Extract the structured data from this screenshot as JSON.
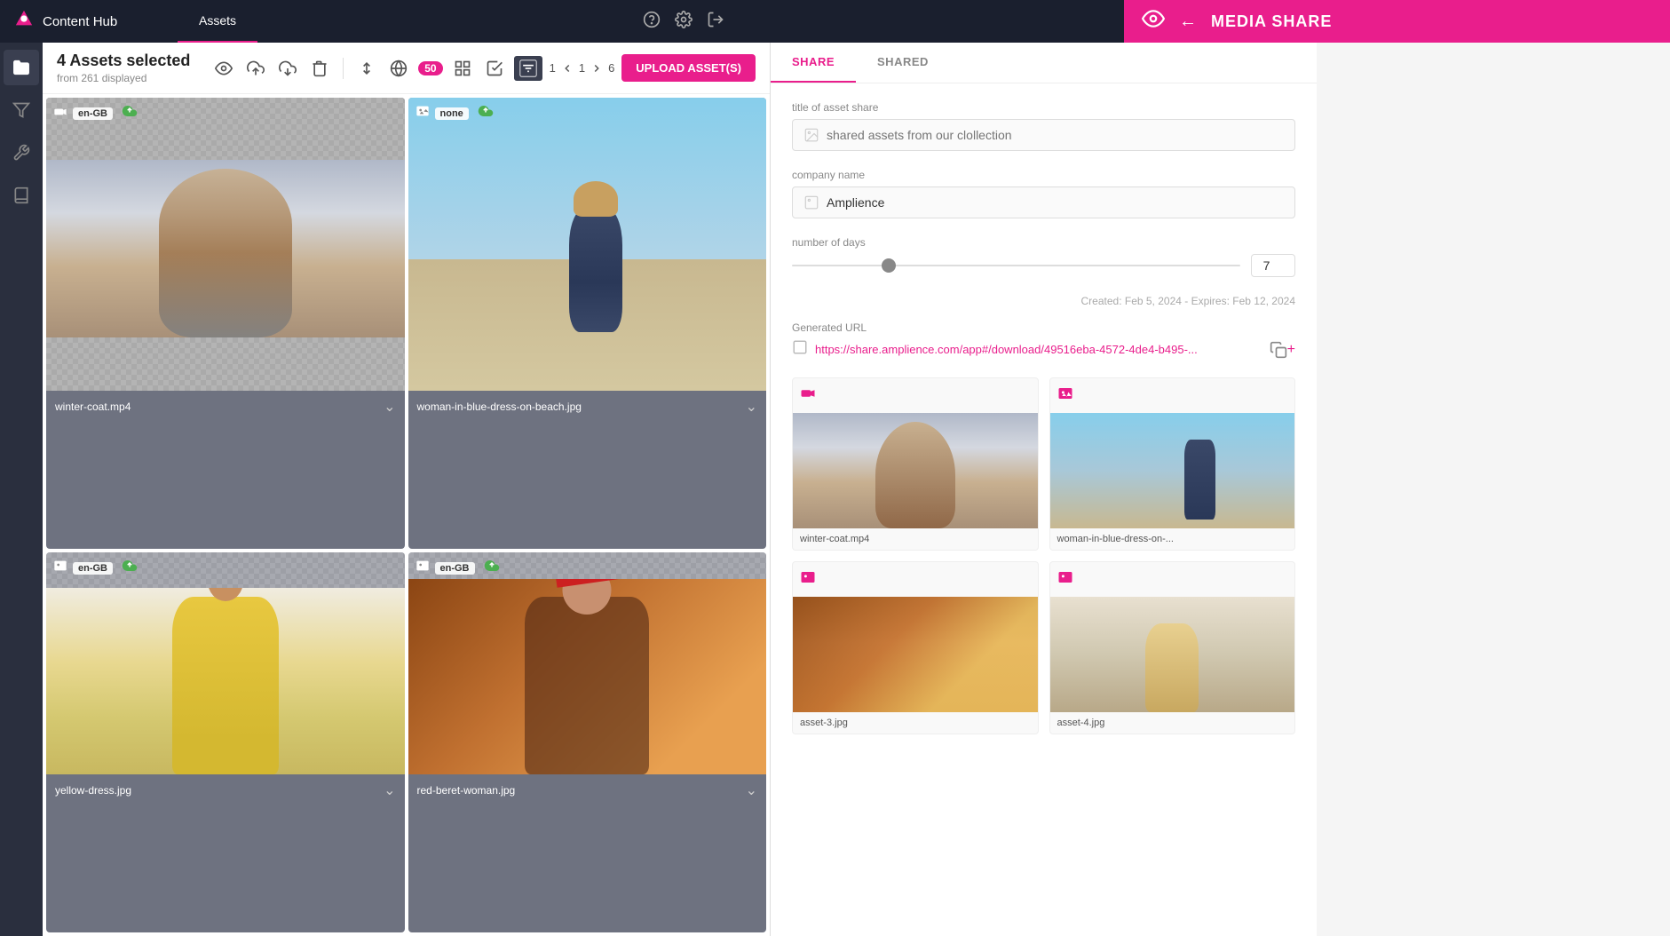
{
  "app": {
    "brand_icon": "△",
    "title": "Content Hub",
    "active_tab": "Assets",
    "tabs": [
      "Assets"
    ]
  },
  "topnav": {
    "right_icons": [
      "help",
      "settings",
      "export"
    ]
  },
  "sidebar": {
    "items": [
      {
        "name": "folder-icon",
        "icon": "📁",
        "active": true
      },
      {
        "name": "filter-icon",
        "icon": "⚗"
      },
      {
        "name": "tools-icon",
        "icon": "🔧"
      },
      {
        "name": "book-icon",
        "icon": "📖"
      }
    ]
  },
  "toolbar": {
    "assets_selected": "4 Assets selected",
    "from_displayed": "from 261 displayed",
    "page_current": "1",
    "page_arrow_left": "‹",
    "page_middle": "1",
    "page_arrow_right": "›",
    "page_end": "6",
    "per_page": "50",
    "upload_button": "UPLOAD ASSET(S)"
  },
  "assets": [
    {
      "name": "winter-coat.mp4",
      "locale": "en-GB",
      "type": "video",
      "has_cloud": true
    },
    {
      "name": "woman-in-blue-dress-on-beach.jpg",
      "locale": "none",
      "type": "image",
      "has_cloud": true
    },
    {
      "name": "yellow-dress.jpg",
      "locale": "en-GB",
      "type": "image",
      "has_cloud": true
    },
    {
      "name": "red-beret-woman.jpg",
      "locale": "en-GB",
      "type": "image",
      "has_cloud": true
    }
  ],
  "media_share": {
    "title": "MEDIA SHARE",
    "back_label": "←",
    "tabs": [
      {
        "label": "SHARE",
        "active": true
      },
      {
        "label": "SHARED",
        "active": false
      }
    ],
    "form": {
      "title_of_asset_share_label": "title of asset share",
      "title_of_asset_share_placeholder": "shared assets from our clollection",
      "company_name_label": "company name",
      "company_name_value": "Amplience",
      "number_of_days_label": "number of days",
      "days_value": "7",
      "created_date": "Created: Feb 5, 2024",
      "expires_date": "Expires: Feb 12, 2024",
      "date_info": "Created: Feb 5, 2024 - Expires: Feb 12, 2024",
      "generated_url_label": "Generated URL",
      "url_value": "https://share.amplience.com/app#/download/49516eba-4572-4de4-b495-..."
    },
    "shared_assets": [
      {
        "name": "winter-coat.mp4",
        "type": "video"
      },
      {
        "name": "woman-in-blue-dress-on-...",
        "type": "image"
      },
      {
        "name": "asset-3",
        "type": "image"
      },
      {
        "name": "asset-4",
        "type": "image"
      }
    ]
  }
}
